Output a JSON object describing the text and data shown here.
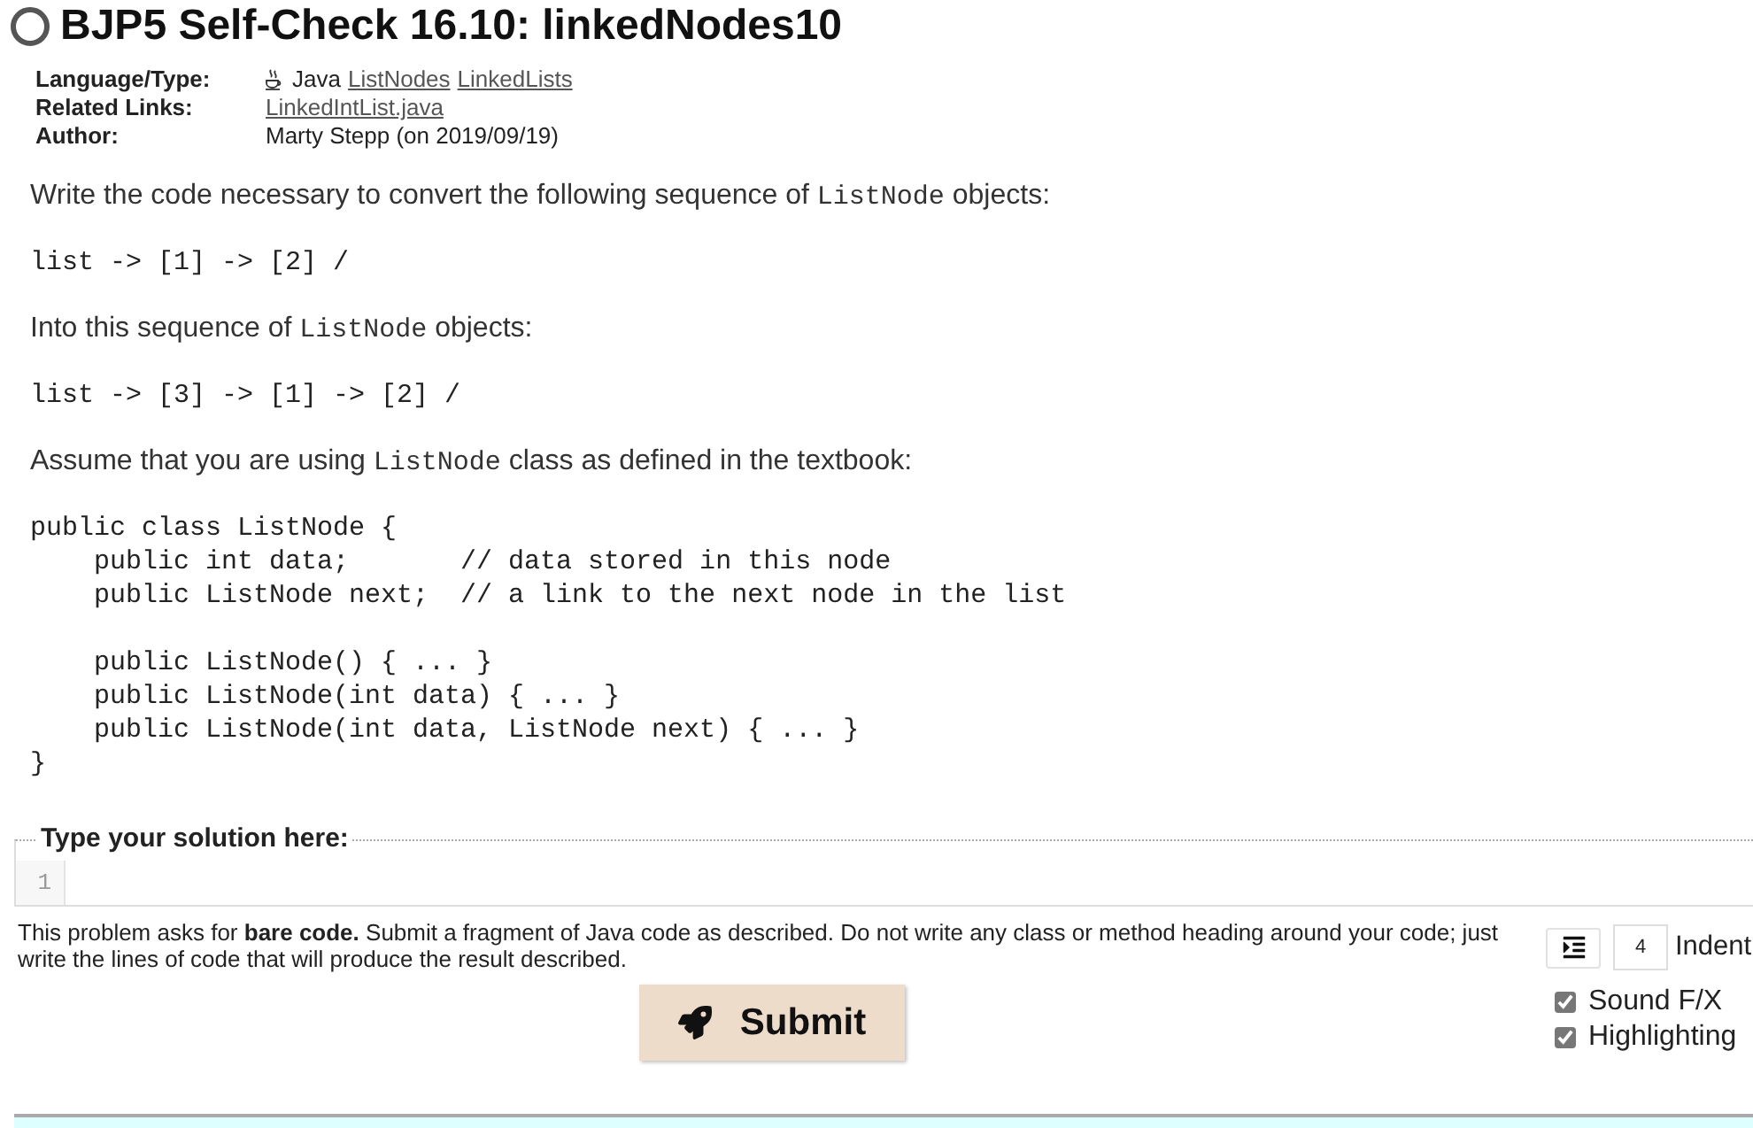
{
  "title": {
    "text": "BJP5 Self-Check 16.10: linkedNodes10",
    "solved": false
  },
  "metadata": [
    {
      "label": "Language/Type:",
      "items": [
        {
          "kind": "language",
          "text": "Java"
        },
        {
          "kind": "link",
          "text": "ListNodes"
        },
        {
          "kind": "link",
          "text": "LinkedLists"
        }
      ]
    },
    {
      "label": "Related Links:",
      "items": [
        {
          "kind": "link",
          "text": "LinkedIntList.java"
        }
      ]
    },
    {
      "label": "Author:",
      "items": [
        {
          "kind": "text",
          "text": "Marty Stepp (on 2019/09/19)"
        }
      ]
    }
  ],
  "description": [
    {
      "kind": "paragraph",
      "parts": [
        {
          "kind": "text",
          "text": "Write the code necessary to convert the following sequence of "
        },
        {
          "kind": "code",
          "text": "ListNode"
        },
        {
          "kind": "text",
          "text": " objects:"
        }
      ]
    },
    {
      "kind": "code",
      "text": "list -> [1] -> [2] /"
    },
    {
      "kind": "paragraph",
      "parts": [
        {
          "kind": "text",
          "text": "Into this sequence of "
        },
        {
          "kind": "code",
          "text": "ListNode"
        },
        {
          "kind": "text",
          "text": " objects:"
        }
      ]
    },
    {
      "kind": "code",
      "text": "list -> [3] -> [1] -> [2] /"
    },
    {
      "kind": "paragraph",
      "parts": [
        {
          "kind": "text",
          "text": "Assume that you are using "
        },
        {
          "kind": "code",
          "text": "ListNode"
        },
        {
          "kind": "text",
          "text": " class as defined in the textbook:"
        }
      ]
    },
    {
      "kind": "code",
      "text": "public class ListNode {\n    public int data;       // data stored in this node\n    public ListNode next;  // a link to the next node in the list\n\n    public ListNode() { ... }\n    public ListNode(int data) { ... }\n    public ListNode(int data, ListNode next) { ... }\n}"
    }
  ],
  "solution": {
    "legend": "Type your solution here:",
    "line_numbers": [
      "1"
    ]
  },
  "instructions": "This problem asks for **bare code.** Submit a fragment of Java code as described. Do not write any class or method heading around your code; just write the lines of code that will produce the result described.",
  "submit": {
    "label": "Submit"
  },
  "indent": {
    "value": "4",
    "label": "Indent"
  },
  "options": [
    {
      "label": "Sound F/X",
      "checked": true
    },
    {
      "label": "Highlighting",
      "checked": true
    }
  ]
}
